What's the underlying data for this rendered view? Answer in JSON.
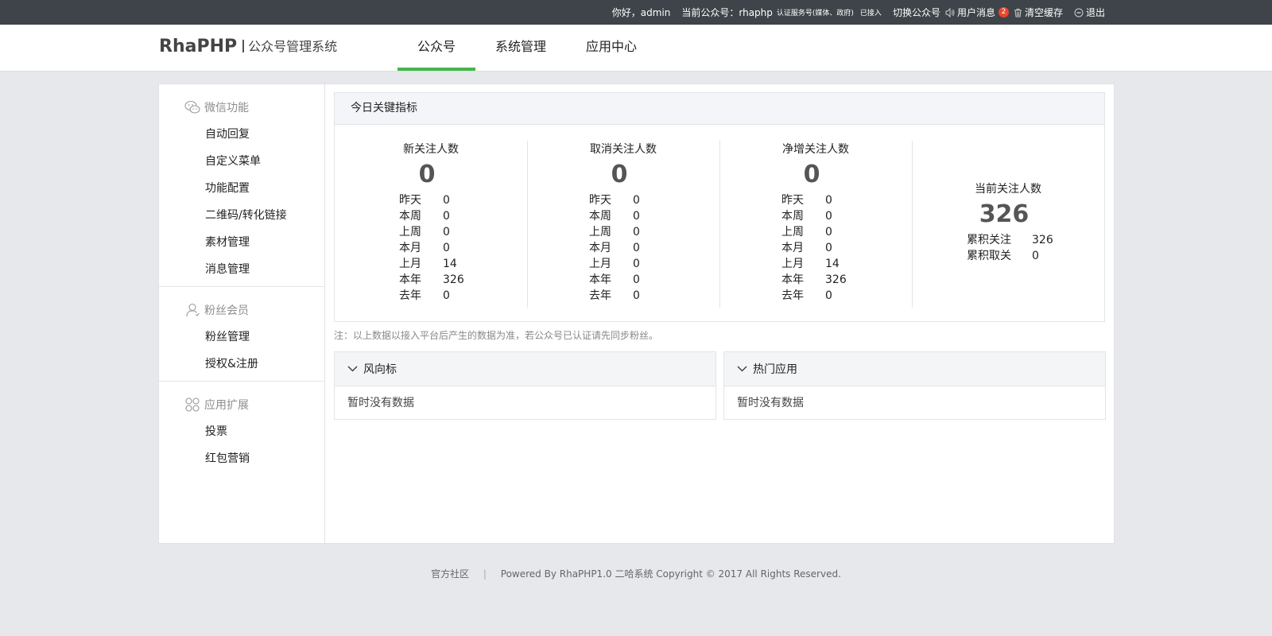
{
  "topbar": {
    "greeting": "你好，admin",
    "current_account_label": "当前公众号：rhaphp",
    "account_type": "认证服务号(媒体、政府)",
    "access_status": "已接入",
    "switch_account": "切换公众号",
    "user_messages": "用户消息",
    "message_count": "2",
    "clear_cache": "清空缓存",
    "logout": "退出"
  },
  "header": {
    "brand": "RhaPHP",
    "subtitle": "公众号管理系统",
    "tabs": [
      {
        "label": "公众号",
        "active": true
      },
      {
        "label": "系统管理",
        "active": false
      },
      {
        "label": "应用中心",
        "active": false
      }
    ]
  },
  "sidebar": {
    "groups": [
      {
        "title": "微信功能",
        "icon": "wechat-icon",
        "items": [
          "自动回复",
          "自定义菜单",
          "功能配置",
          "二维码/转化链接",
          "素材管理",
          "消息管理"
        ]
      },
      {
        "title": "粉丝会员",
        "icon": "user-icon",
        "items": [
          "粉丝管理",
          "授权&注册"
        ]
      },
      {
        "title": "应用扩展",
        "icon": "apps-icon",
        "items": [
          "投票",
          "红包营销"
        ]
      }
    ]
  },
  "stats": {
    "title": "今日关键指标",
    "columns": [
      {
        "title": "新关注人数",
        "value": "0",
        "rows": [
          [
            "昨天",
            "0"
          ],
          [
            "本周",
            "0"
          ],
          [
            "上周",
            "0"
          ],
          [
            "本月",
            "0"
          ],
          [
            "上月",
            "14"
          ],
          [
            "本年",
            "326"
          ],
          [
            "去年",
            "0"
          ]
        ]
      },
      {
        "title": "取消关注人数",
        "value": "0",
        "rows": [
          [
            "昨天",
            "0"
          ],
          [
            "本周",
            "0"
          ],
          [
            "上周",
            "0"
          ],
          [
            "本月",
            "0"
          ],
          [
            "上月",
            "0"
          ],
          [
            "本年",
            "0"
          ],
          [
            "去年",
            "0"
          ]
        ]
      },
      {
        "title": "净增关注人数",
        "value": "0",
        "rows": [
          [
            "昨天",
            "0"
          ],
          [
            "本周",
            "0"
          ],
          [
            "上周",
            "0"
          ],
          [
            "本月",
            "0"
          ],
          [
            "上月",
            "14"
          ],
          [
            "本年",
            "326"
          ],
          [
            "去年",
            "0"
          ]
        ]
      },
      {
        "title": "当前关注人数",
        "value": "326",
        "rows": [
          [
            "累积关注",
            "326"
          ],
          [
            "累积取关",
            "0"
          ]
        ]
      }
    ],
    "note": "注：以上数据以接入平台后产生的数据为准，若公众号已认证请先同步粉丝。"
  },
  "boxes": [
    {
      "title": "风向标",
      "empty": "暂时没有数据"
    },
    {
      "title": "热门应用",
      "empty": "暂时没有数据"
    }
  ],
  "footer": {
    "community": "官方社区",
    "separator": "|",
    "copyright": "Powered By RhaPHP1.0 二哈系统 Copyright © 2017 All Rights Reserved."
  },
  "colors": {
    "accent": "#44b549",
    "topbar": "#3e4449",
    "badge": "#e8462f",
    "page_bg": "#e7e8eb"
  }
}
